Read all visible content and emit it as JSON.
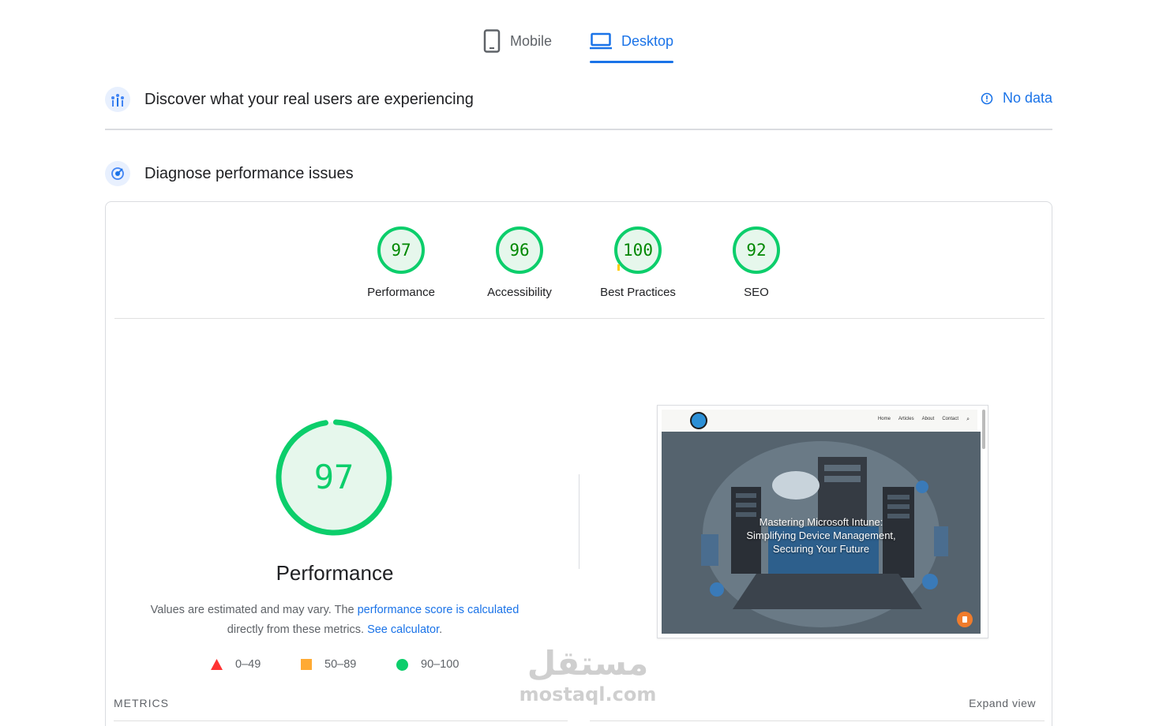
{
  "tabs": [
    {
      "label": "Mobile",
      "active": false
    },
    {
      "label": "Desktop",
      "active": true
    }
  ],
  "real_users": {
    "title": "Discover what your real users are experiencing",
    "status": "No data"
  },
  "diagnose": {
    "title": "Diagnose performance issues"
  },
  "scores": [
    {
      "label": "Performance",
      "value": "97"
    },
    {
      "label": "Accessibility",
      "value": "96"
    },
    {
      "label": "Best Practices",
      "value": "100"
    },
    {
      "label": "SEO",
      "value": "92"
    }
  ],
  "performance": {
    "score": "97",
    "title": "Performance",
    "desc_prefix": "Values are estimated and may vary. The ",
    "desc_link1": "performance score is calculated",
    "desc_middle": "directly from these metrics. ",
    "desc_link2": "See calculator",
    "desc_suffix": "."
  },
  "legend": [
    {
      "range": "0–49",
      "shape": "triangle",
      "color": "#ff3333"
    },
    {
      "range": "50–89",
      "shape": "square",
      "color": "#ffaa33"
    },
    {
      "range": "90–100",
      "shape": "circle",
      "color": "#0cce6b"
    }
  ],
  "screenshot": {
    "nav_links": [
      "Home",
      "Articles",
      "About",
      "Contact"
    ],
    "hero_text": "Mastering Microsoft Intune: Simplifying Device Management, Securing Your Future"
  },
  "metrics": {
    "label": "METRICS",
    "expand": "Expand view"
  },
  "watermark": {
    "arabic": "مستقل",
    "latin": "mostaql.com"
  },
  "colors": {
    "accent": "#1a73e8",
    "pass": "#0cce6b",
    "pass_text": "#008800",
    "average": "#ffaa33",
    "fail": "#ff3333"
  }
}
